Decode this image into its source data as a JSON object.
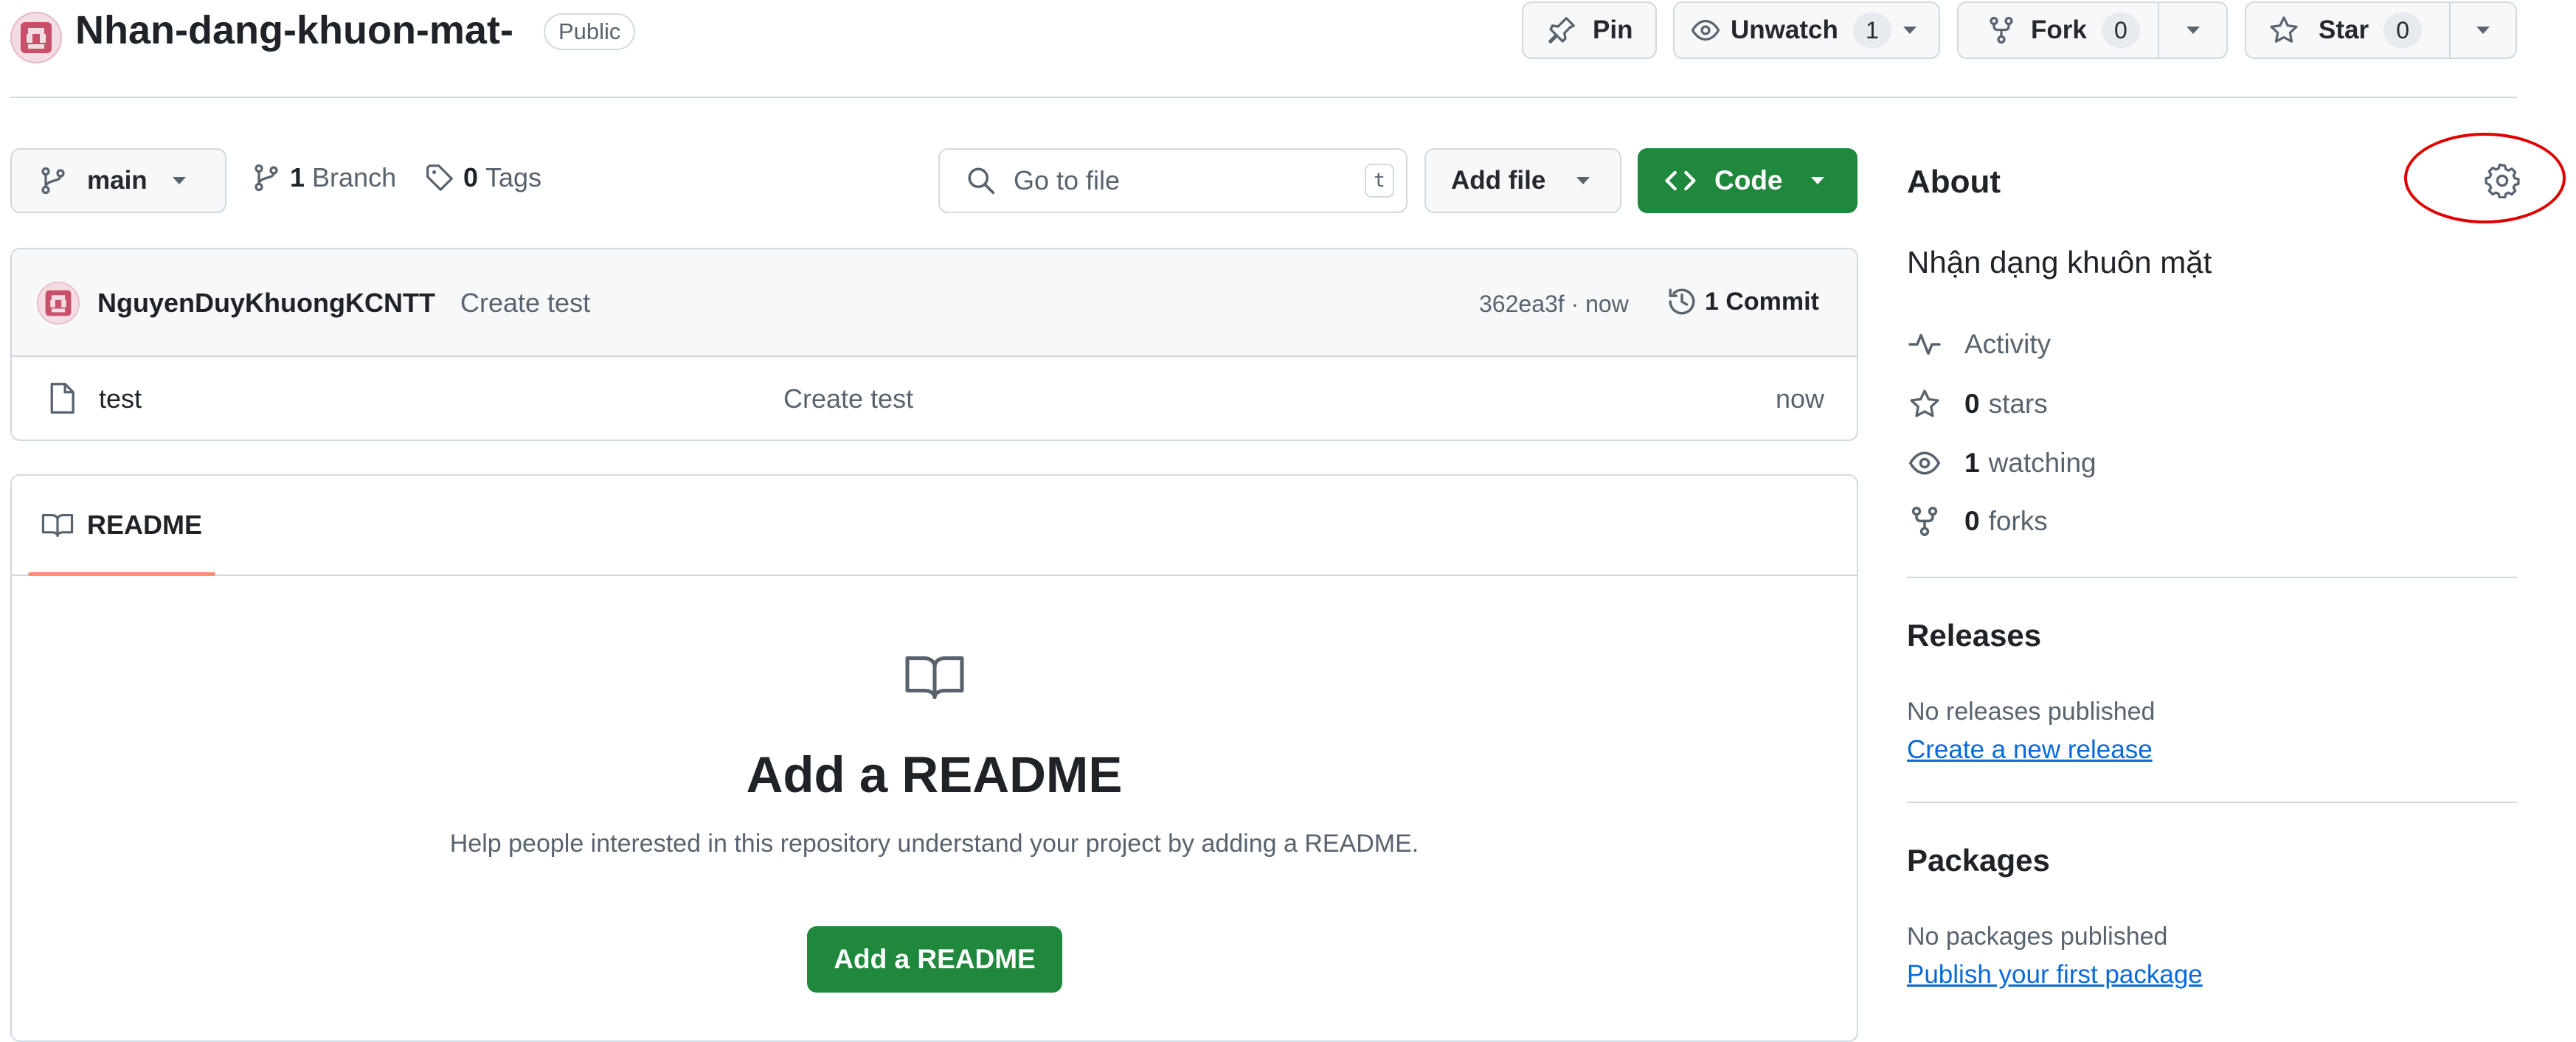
{
  "repo": {
    "name": "Nhan-dang-khuon-mat-",
    "visibility": "Public",
    "avatar_icon": "identicon-avatar"
  },
  "actions": {
    "pin_label": "Pin",
    "unwatch_label": "Unwatch",
    "unwatch_count": "1",
    "fork_label": "Fork",
    "fork_count": "0",
    "star_label": "Star",
    "star_count": "0"
  },
  "toolbar": {
    "branch_name": "main",
    "branch_count": "1",
    "branch_label": "Branch",
    "tag_count": "0",
    "tag_label": "Tags",
    "search_placeholder": "Go to file",
    "search_shortcut": "t",
    "add_file_label": "Add file",
    "code_label": "Code"
  },
  "commit": {
    "author": "NguyenDuyKhuongKCNTT",
    "message": "Create test",
    "hash_time": "362ea3f · now",
    "commit_count_label": "1 Commit"
  },
  "files": [
    {
      "name": "test",
      "message": "Create test",
      "time": "now"
    }
  ],
  "readme": {
    "tab_label": "README",
    "heading": "Add a README",
    "description": "Help people interested in this repository understand your project by adding a README.",
    "button_label": "Add a README"
  },
  "about": {
    "title": "About",
    "description": "Nhận dạng khuôn mặt",
    "activity_label": "Activity",
    "stars_count": "0",
    "stars_label": "stars",
    "watching_count": "1",
    "watching_label": "watching",
    "forks_count": "0",
    "forks_label": "forks"
  },
  "releases": {
    "title": "Releases",
    "empty_text": "No releases published",
    "link": "Create a new release"
  },
  "packages": {
    "title": "Packages",
    "empty_text": "No packages published",
    "link": "Publish your first package"
  },
  "colors": {
    "primary_green": "#1f883d",
    "link_blue": "#0969da",
    "annotation_red": "#e00000",
    "tab_underline": "#fd8c73"
  }
}
